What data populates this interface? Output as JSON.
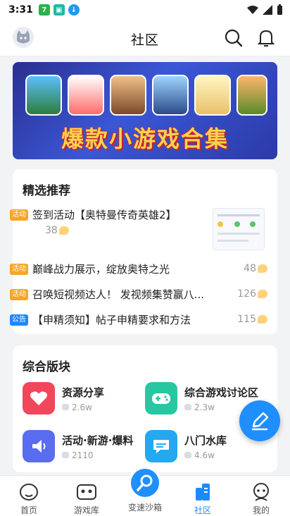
{
  "status_bar": {
    "time": "3:31",
    "icons": [
      "app-7-icon",
      "app-tv-icon",
      "download-icon",
      "wifi-icon",
      "signal-icon",
      "battery-icon"
    ]
  },
  "header": {
    "title": "社区"
  },
  "banner": {
    "text": "爆款小游戏合集"
  },
  "featured": {
    "title": "精选推荐",
    "posts": [
      {
        "tag": "活动",
        "tag_color": "#f5a623",
        "text": "签到活动【奥特曼传奇英雄2】",
        "count": "38"
      },
      {
        "tag": "活动",
        "tag_color": "#f5a623",
        "text": "巅峰战力展示，绽放奥特之光",
        "count": "48"
      },
      {
        "tag": "活动",
        "tag_color": "#f5a623",
        "text": "召唤短视频达人！ 发视频集赞赢八...",
        "count": "126"
      },
      {
        "tag": "公告",
        "tag_color": "#1e88ff",
        "text": "【申精须知】帖子申精要求和方法",
        "count": "115"
      }
    ]
  },
  "boards": {
    "title": "综合版块",
    "items": [
      {
        "name": "资源分享",
        "count": "2.6w",
        "icon": "heart-icon",
        "color": "#f2465a"
      },
      {
        "name": "综合游戏讨论区",
        "count": "2.3w",
        "icon": "gamepad-icon",
        "color": "#27c7a1"
      },
      {
        "name": "活动·新游·爆料",
        "count": "2110",
        "icon": "speaker-icon",
        "color": "#5a6cf0"
      },
      {
        "name": "八门水库",
        "count": "4.6w",
        "icon": "chat-icon",
        "color": "#25a8f0"
      }
    ]
  },
  "bottom_nav": [
    {
      "label": "首页",
      "icon": "home-icon"
    },
    {
      "label": "游戏库",
      "icon": "game-library-icon"
    },
    {
      "label": "变速沙箱",
      "icon": "search-wrench-icon"
    },
    {
      "label": "社区",
      "icon": "community-icon",
      "active": true
    },
    {
      "label": "我的",
      "icon": "profile-icon"
    }
  ],
  "colors": {
    "accent": "#1e88ff",
    "activity_tag": "#f5a623",
    "notice_tag": "#1e88ff"
  }
}
